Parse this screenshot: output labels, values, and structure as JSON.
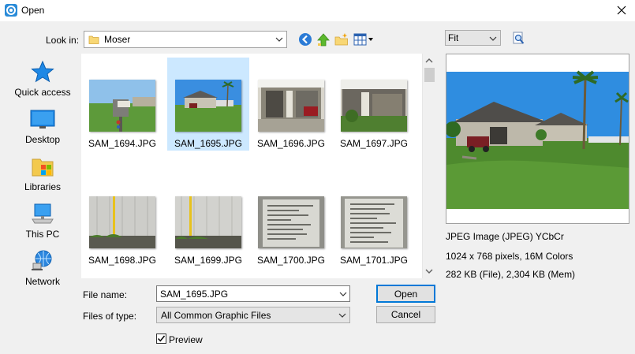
{
  "window": {
    "title": "Open"
  },
  "lookin": {
    "label": "Look in:",
    "value": "Moser"
  },
  "places": [
    {
      "label": "Quick access",
      "icon": "star-icon"
    },
    {
      "label": "Desktop",
      "icon": "desktop-icon"
    },
    {
      "label": "Libraries",
      "icon": "libraries-icon"
    },
    {
      "label": "This PC",
      "icon": "computer-icon"
    },
    {
      "label": "Network",
      "icon": "network-icon"
    }
  ],
  "files": [
    {
      "name": "SAM_1694.JPG",
      "selected": false
    },
    {
      "name": "SAM_1695.JPG",
      "selected": true
    },
    {
      "name": "SAM_1696.JPG",
      "selected": false
    },
    {
      "name": "SAM_1697.JPG",
      "selected": false
    },
    {
      "name": "SAM_1698.JPG",
      "selected": false
    },
    {
      "name": "SAM_1699.JPG",
      "selected": false
    },
    {
      "name": "SAM_1700.JPG",
      "selected": false
    },
    {
      "name": "SAM_1701.JPG",
      "selected": false
    }
  ],
  "filename": {
    "label": "File name:",
    "value": "SAM_1695.JPG"
  },
  "filetype": {
    "label": "Files of type:",
    "value": "All Common Graphic Files"
  },
  "buttons": {
    "open": "Open",
    "cancel": "Cancel"
  },
  "preview": {
    "checkbox_label": "Preview",
    "checked": true,
    "zoom": "Fit",
    "info_type": "JPEG Image (JPEG) YCbCr",
    "info_size": "1024 x 768 pixels, 16M Colors",
    "info_bytes": "282 KB (File), 2,304 KB (Mem)"
  },
  "colors": {
    "accent": "#0078d7",
    "selection": "#cce8ff",
    "sky": "#2f8de0",
    "grass": "#4e8a2e"
  }
}
